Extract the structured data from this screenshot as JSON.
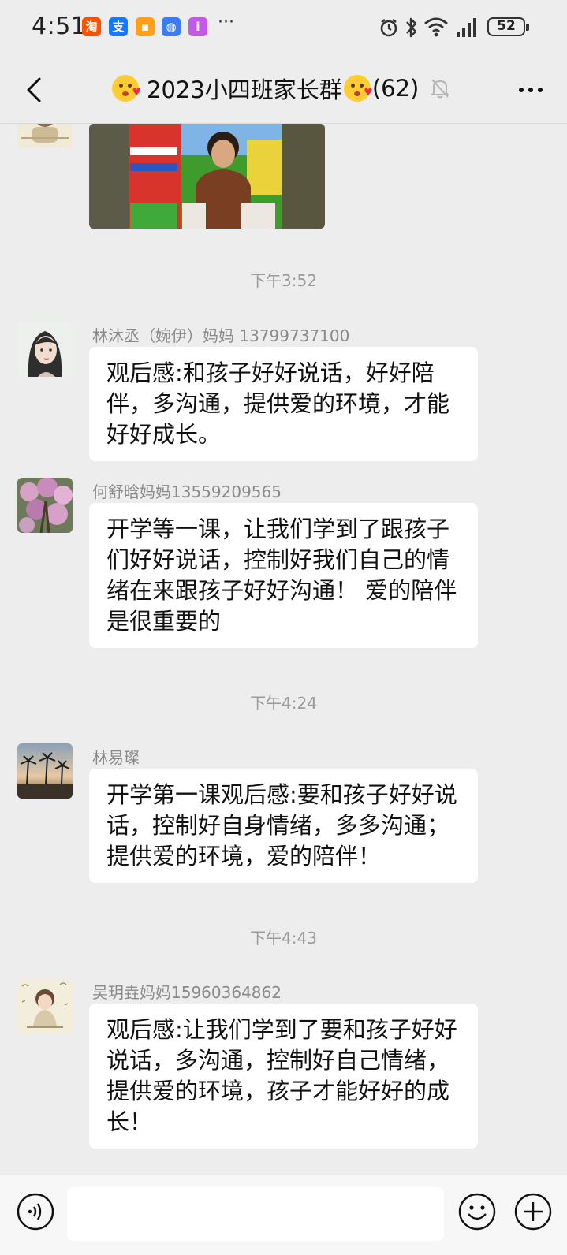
{
  "status_bar": {
    "time": "4:51",
    "more": "···",
    "battery": "52",
    "apps": [
      {
        "icon": "taobao-app-icon",
        "glyph": "淘",
        "color": "#ff5000"
      },
      {
        "icon": "alipay-app-icon",
        "glyph": "支",
        "color": "#1677ff"
      },
      {
        "icon": "orange-app-icon",
        "glyph": "▪",
        "color": "#ff9f1a"
      },
      {
        "icon": "browser-app-icon",
        "glyph": "◍",
        "color": "#3a7bf6"
      },
      {
        "icon": "purple-app-icon",
        "glyph": "i",
        "color": "#c15ae6"
      }
    ]
  },
  "header": {
    "title": "2023小四班家长群",
    "member_count": "(62)"
  },
  "messages": [
    {
      "type": "time",
      "text": "下午3:52"
    },
    {
      "type": "text",
      "sender": "林沐丞（婉伊）妈妈 13799737100",
      "avatar": "girl-portrait",
      "text": "观后感:和孩子好好说话，好好陪伴，多沟通，提供爱的环境，才能好好成长。"
    },
    {
      "type": "text",
      "sender": "何舒晗妈妈13559209565",
      "avatar": "flowers",
      "text": "开学等一课，让我们学到了跟孩子们好好说话，控制好我们自己的情绪在来跟孩子好好沟通！ 爱的陪伴是很重要的"
    },
    {
      "type": "time",
      "text": "下午4:24"
    },
    {
      "type": "text",
      "sender": "林易璨",
      "avatar": "palm-trees",
      "text": "开学第一课观后感:要和孩子好好说话，控制好自身情绪，多多沟通；提供爱的环境，爱的陪伴！"
    },
    {
      "type": "time",
      "text": "下午4:43"
    },
    {
      "type": "text",
      "sender": "吴玥垚妈妈15960364862",
      "avatar": "cartoon-girl",
      "text": "观后感:让我们学到了要和孩子好好说话，多沟通，控制好自己情绪，提供爱的环境，孩子才能好好的成长！"
    }
  ],
  "input": {
    "value": ""
  },
  "colors": {
    "background": "#ededed",
    "bubble": "#ffffff",
    "meta_text": "#8a8a8a"
  }
}
